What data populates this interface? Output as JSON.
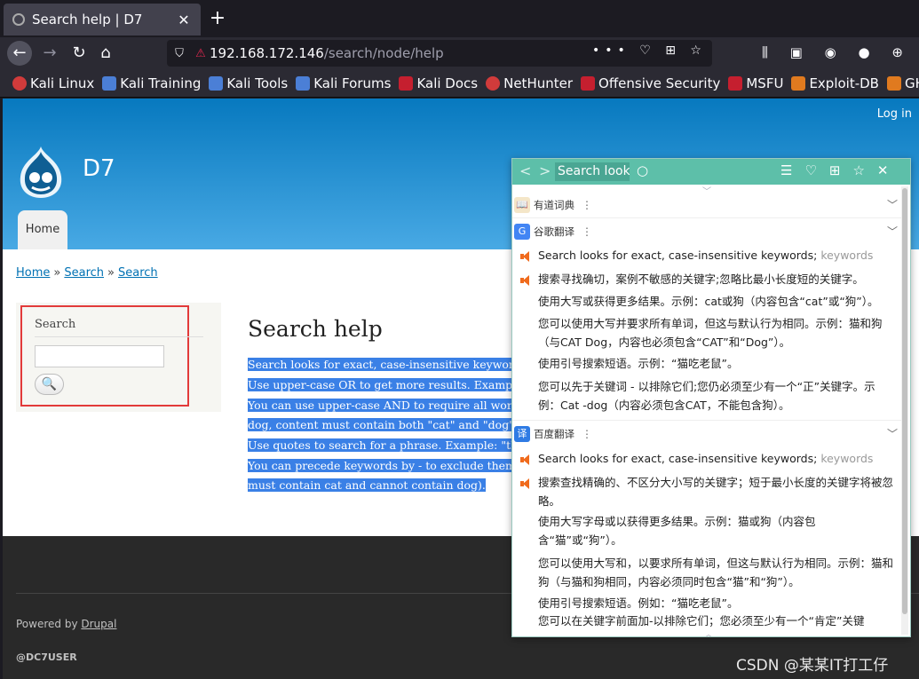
{
  "browser": {
    "tab_title": "Search help | D7",
    "tab_close": "✕",
    "new_tab": "+",
    "url_host": "192.168.172.146",
    "url_path": "/search/node/help",
    "url_tools": "••• ♡ ⊞ ☆",
    "right_tools": "⫼ ▣ ◉ ● ⊕",
    "bookmarks": [
      {
        "label": "Kali Linux",
        "icon": "kali-icon"
      },
      {
        "label": "Kali Training",
        "icon": "kali-training-icon"
      },
      {
        "label": "Kali Tools",
        "icon": "kali-tools-icon"
      },
      {
        "label": "Kali Forums",
        "icon": "kali-forums-icon"
      },
      {
        "label": "Kali Docs",
        "icon": "kali-docs-icon"
      },
      {
        "label": "NetHunter",
        "icon": "nethunter-icon"
      },
      {
        "label": "Offensive Security",
        "icon": "offsec-icon"
      },
      {
        "label": "MSFU",
        "icon": "msfu-icon"
      },
      {
        "label": "Exploit-DB",
        "icon": "exploitdb-icon"
      },
      {
        "label": "GHDB",
        "icon": "ghdb-icon"
      }
    ]
  },
  "site": {
    "login": "Log in",
    "name": "D7",
    "home_tab": "Home",
    "breadcrumb": [
      "Home",
      "Search",
      "Search"
    ],
    "breadcrumb_sep": "»",
    "search_block_title": "Search",
    "search_button": "🔍",
    "page_title": "Search help",
    "help_lines": [
      "Search looks for exact, case-insensitive keywords; ke",
      "Use upper-case OR to get more results. Example: cat",
      "You can use upper-case AND to require all words, bu",
      "dog, content must contain both \"cat\" and \"dog\").",
      "Use quotes to search for a phrase. Example: \"the cat",
      "You can precede keywords by - to exclude them; you",
      "must contain cat and cannot contain dog)."
    ],
    "powered_prefix": "Powered by ",
    "powered_link": "Drupal",
    "footer_user": "@DC7USER"
  },
  "popup": {
    "nav_back": "<",
    "nav_forward": ">",
    "query": "Search looks",
    "search_icon": "○",
    "right_icons": "☰♡⊞☆✕",
    "collapse_top": "﹀",
    "collapse_bottom": "︿",
    "youdao": {
      "name": "有道词典",
      "icon": "📖"
    },
    "google": {
      "name": "谷歌翻译",
      "icon": "G",
      "source_start": "Search looks for exact, case-insensitive keywords;",
      "source_fade": " keywords",
      "lines": [
        "搜索寻找确切，案例不敏感的关键字;忽略比最小长度短的关键字。",
        "使用大写或获得更多结果。示例：cat或狗（内容包含“cat”或“狗”）。",
        "您可以使用大写并要求所有单词，但这与默认行为相同。示例：猫和狗（与CAT Dog，内容也必须包含“CAT”和“Dog”）。",
        "使用引号搜索短语。示例：“猫吃老鼠”。",
        "您可以先于关键词 - 以排除它们;您仍必须至少有一个“正”关键字。示例：Cat -dog（内容必须包含CAT，不能包含狗）。"
      ]
    },
    "baidu": {
      "name": "百度翻译",
      "icon": "译",
      "source_start": "Search looks for exact, case-insensitive keywords;",
      "source_fade": " keywords",
      "lines": [
        "搜索查找精确的、不区分大小写的关键字；短于最小长度的关键字将被忽略。",
        "使用大写字母或以获得更多结果。示例：猫或狗（内容包含“猫”或“狗”）。",
        "您可以使用大写和，以要求所有单词，但这与默认行为相同。示例：猫和狗（与猫和狗相同，内容必须同时包含“猫”和“狗”）。",
        "使用引号搜索短语。例如：“猫吃老鼠”。",
        "您可以在关键字前面加-以排除它们；您必须至少有一个“肯定”关键"
      ],
      "toggle": "﹀"
    },
    "toggle_icon": "﹀",
    "menu_dots": "⋮"
  },
  "watermark": "CSDN @某某IT打工仔",
  "colors": {
    "header": "#0779bf",
    "selection": "#3a80e6",
    "popup_bar": "#5dbfa9",
    "speaker": "#f06b1d",
    "highlight_box": "#e23a3a"
  }
}
